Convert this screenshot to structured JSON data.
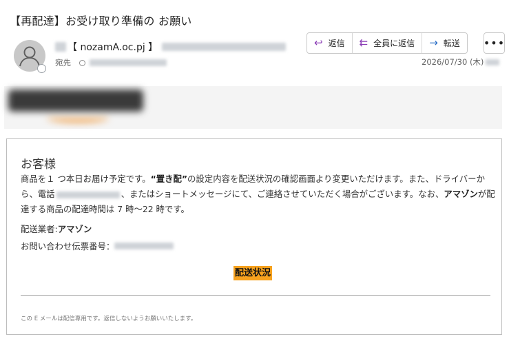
{
  "email": {
    "subject": "【再配達】お受け取り準備の お願い",
    "sender_name": "【 nozamA.oc.pj 】",
    "recipient_label": "宛先",
    "date": "2026/07/30 (木)"
  },
  "actions": {
    "reply": "返信",
    "reply_all": "全員に返信",
    "forward": "転送",
    "more": "•••"
  },
  "icons": {
    "reply": "reply-arrow-icon",
    "reply_all": "reply-all-icon",
    "forward": "forward-arrow-icon",
    "more": "more-options-icon",
    "avatar": "person-icon",
    "presence": "presence-status-icon"
  },
  "colors": {
    "cta": "#f7a21e",
    "reply_all_icon": "#8a3bb5",
    "forward_icon": "#2b6fc7",
    "logo_smile": "#f0a04a"
  },
  "body": {
    "greeting": "お客様",
    "para_1": "商品を１ つ本日お届け予定です。",
    "para_bold": "“置き配”",
    "para_2": "の設定内容を配送状況の確認画面より変更いただけます。また、ドライバーから、電話",
    "para_3": "、またはショートメッセージにて、ご連絡させていただく場合がございます。なお、",
    "para_bold_2": "アマゾン",
    "para_4": "が配達する商品の配達時間は 7 時～22 時です。",
    "carrier_label": "配送業者:",
    "carrier_value": "アマゾン",
    "tracking_label": "お問い合わせ伝票番号：",
    "cta_label": "配送状況",
    "footer": "この E メールは配信専用です。返信しないようお願いいたします。"
  }
}
